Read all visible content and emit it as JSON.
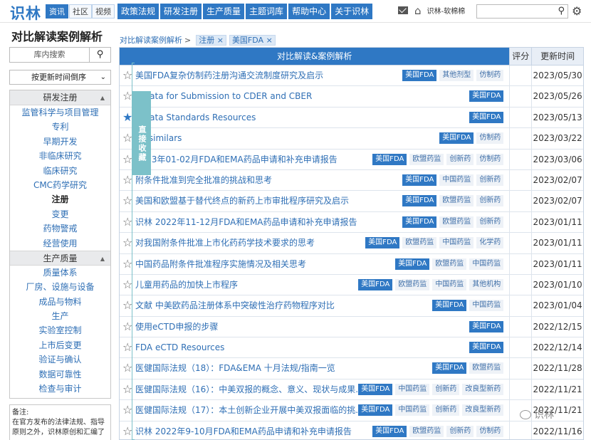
{
  "header": {
    "logo": "识林",
    "subtabs": [
      "资讯",
      "社区",
      "视频"
    ],
    "nav": [
      "政策法规",
      "研发注册",
      "生产质量",
      "主题词库",
      "帮助中心",
      "关于识林"
    ],
    "user": "识林-软棉棉"
  },
  "sidebar": {
    "title": "对比解读案例解析",
    "search_placeholder": "库内搜索",
    "sort": "按更新时间倒序",
    "sections": [
      {
        "header": "研发注册",
        "items": [
          "监管科学与项目管理",
          "专利",
          "早期开发",
          "非临床研究",
          "临床研究",
          "CMC药学研究",
          "注册",
          "变更",
          "药物警戒",
          "经营使用"
        ]
      },
      {
        "header": "生产质量",
        "items": [
          "质量体系",
          "厂房、设施与设备",
          "成品与物料",
          "生产",
          "实验室控制",
          "上市后变更",
          "验证与确认",
          "数据可靠性",
          "检查与审计"
        ]
      }
    ],
    "selected_item": "注册",
    "note": "备注:\n在官方发布的法律法规、指导原则之外，识林原创和汇编了"
  },
  "breadcrumb": {
    "root": "对比解读案例解析",
    "sep": ">",
    "tags": [
      "注册 ×",
      "美国FDA ×"
    ]
  },
  "table": {
    "headers": [
      "对比解读&案例解析",
      "评分",
      "更新时间"
    ],
    "rows": [
      {
        "title": "美国FDA复杂仿制药注册沟通交流制度研究及启示",
        "tags": [
          "美国FDA",
          "其他剂型",
          "仿制药"
        ],
        "date": "2023/05/30",
        "starred": false
      },
      {
        "title": "y Data for Submission to CDER and CBER",
        "tags": [
          "美国FDA"
        ],
        "date": "2023/05/26",
        "starred": false
      },
      {
        "title": "y Data Standards Resources",
        "tags": [
          "美国FDA"
        ],
        "date": "2023/05/13",
        "starred": true
      },
      {
        "title": "Biosimilars",
        "tags": [
          "美国FDA",
          "仿制药"
        ],
        "date": "2023/03/22",
        "starred": false
      },
      {
        "title": "2023年01-02月FDA和EMA药品申请和补充申请报告",
        "tags": [
          "美国FDA",
          "欧盟药监",
          "创新药",
          "仿制药"
        ],
        "date": "2023/03/06",
        "starred": false
      },
      {
        "title": "附条件批准到完全批准的挑战和思考",
        "tags": [
          "美国FDA",
          "中国药监",
          "创新药"
        ],
        "date": "2023/02/07",
        "starred": false
      },
      {
        "title": "美国和欧盟基于替代终点的新药上市审批程序研究及启示",
        "tags": [
          "美国FDA",
          "欧盟药监",
          "创新药"
        ],
        "date": "2023/02/07",
        "starred": false
      },
      {
        "title": "识林 2022年11-12月FDA和EMA药品申请和补充申请报告",
        "tags": [
          "美国FDA",
          "欧盟药监",
          "创新药"
        ],
        "date": "2023/01/11",
        "starred": false
      },
      {
        "title": "对我国附条件批准上市化药药学技术要求的思考",
        "tags": [
          "美国FDA",
          "欧盟药监",
          "中国药监",
          "化学药"
        ],
        "date": "2023/01/11",
        "starred": false
      },
      {
        "title": "中国药品附条件批准程序实施情况及相关思考",
        "tags": [
          "美国FDA",
          "欧盟药监",
          "中国药监"
        ],
        "date": "2023/01/11",
        "starred": false
      },
      {
        "title": "儿童用药品的加快上市程序",
        "tags": [
          "美国FDA",
          "欧盟药监",
          "中国药监",
          "其他机构"
        ],
        "date": "2023/01/10",
        "starred": false
      },
      {
        "title": "文献 中美欧药品注册体系中突破性治疗药物程序对比",
        "tags": [
          "美国FDA",
          "中国药监"
        ],
        "date": "2023/01/04",
        "starred": false
      },
      {
        "title": "使用eCTD申报的步骤",
        "tags": [
          "美国FDA"
        ],
        "date": "2022/12/15",
        "starred": false
      },
      {
        "title": "FDA eCTD Resources",
        "tags": [
          "美国FDA"
        ],
        "date": "2022/12/14",
        "starred": false
      },
      {
        "title": "医健国际法规（18）：FDA&EMA 十月法规/指南一览",
        "tags": [
          "美国FDA",
          "欧盟药监"
        ],
        "date": "2022/11/28",
        "starred": false
      },
      {
        "title": "医健国际法规（16）：中美双报的概念、意义、现状与成果...",
        "tags": [
          "美国FDA",
          "中国药监",
          "创新药",
          "改良型新药"
        ],
        "date": "2022/11/21",
        "starred": false
      },
      {
        "title": "医健国际法规（17）：本土创新企业开展中美双报面临的挑...",
        "tags": [
          "美国FDA",
          "中国药监",
          "创新药",
          "改良型新药"
        ],
        "date": "2022/11/21",
        "starred": false
      },
      {
        "title": "识林 2022年9-10月FDA和EMA药品申请和补充申请报告",
        "tags": [
          "美国FDA",
          "欧盟药监",
          "创新药",
          "仿制药"
        ],
        "date": "2022/11/16",
        "starred": false
      }
    ]
  },
  "collect_panel": "直接收藏",
  "watermark": "识林"
}
